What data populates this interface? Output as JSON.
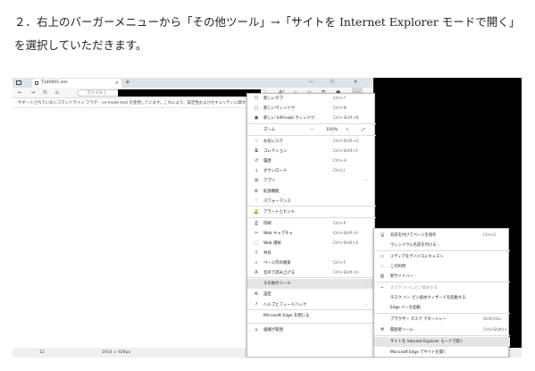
{
  "instruction": "２．右上のバーガーメニューから「その他ツール」→「サイトを Internet Explorer モードで開く」を選択していただきます。",
  "browser": {
    "tab_title": "T140001.xml",
    "tab_close": "×",
    "new_tab": "+",
    "window_buttons": {
      "minimize": "—",
      "maximize": "☐",
      "close": "✕"
    },
    "address_label": "ファイル |",
    "infobar_text": "サポートされていないコマンドライン フラグ: --ie-mode-test を使用しています。これにより、安定性およびセキュリティに関する",
    "status_left": "12",
    "status_mid": "1914 × 929px"
  },
  "menu": {
    "items": [
      {
        "icon": "new-tab-icon",
        "glyph": "☐",
        "label": "新しいタブ",
        "shortcut": "Ctrl+T"
      },
      {
        "icon": "new-window-icon",
        "glyph": "▢",
        "label": "新しいウィンドウ",
        "shortcut": "Ctrl+N"
      },
      {
        "icon": "inprivate-icon",
        "glyph": "▣",
        "label": "新しい InPrivate ウィンドウ",
        "shortcut": "Ctrl+Shift+N"
      },
      {
        "icon": "favorites-icon",
        "glyph": "☆",
        "label": "お気に入り",
        "shortcut": "Ctrl+Shift+O"
      },
      {
        "icon": "collections-icon",
        "glyph": "⧉",
        "label": "コレクション",
        "shortcut": "Ctrl+Shift+Y"
      },
      {
        "icon": "history-icon",
        "glyph": "↺",
        "label": "履歴",
        "shortcut": "Ctrl+H"
      },
      {
        "icon": "download-icon",
        "glyph": "↓",
        "label": "ダウンロード",
        "shortcut": "Ctrl+J"
      },
      {
        "icon": "apps-icon",
        "glyph": "⊞",
        "label": "アプリ",
        "arrow": "›"
      },
      {
        "icon": "extensions-icon",
        "glyph": "⚙",
        "label": "拡張機能"
      },
      {
        "icon": "performance-icon",
        "glyph": "♡",
        "label": "パフォーマンス"
      },
      {
        "icon": "alerts-icon",
        "glyph": "🔔",
        "label": "アラートとヒント"
      },
      {
        "icon": "print-icon",
        "glyph": "⎙",
        "label": "印刷",
        "shortcut": "Ctrl+P"
      },
      {
        "icon": "web-capture-icon",
        "glyph": "✂",
        "label": "Web キャプチャ",
        "shortcut": "Ctrl+Shift+S"
      },
      {
        "icon": "web-select-icon",
        "glyph": "⬚",
        "label": "Web 選択",
        "shortcut": "Ctrl+Shift+X"
      },
      {
        "icon": "share-icon",
        "glyph": "⇪",
        "label": "共有"
      },
      {
        "icon": "find-icon",
        "glyph": "⌕",
        "label": "ページ内の検索",
        "shortcut": "Ctrl+F"
      },
      {
        "icon": "read-aloud-icon",
        "glyph": "A",
        "label": "音声で読み上げる",
        "shortcut": "Ctrl+Shift+U"
      },
      {
        "icon": "more-tools-icon",
        "glyph": "",
        "label": "その他のツール",
        "arrow": "›"
      },
      {
        "icon": "settings-icon",
        "glyph": "⚙",
        "label": "設定"
      },
      {
        "icon": "help-icon",
        "glyph": "?",
        "label": "ヘルプとフィードバック",
        "arrow": "›"
      },
      {
        "icon": "close-edge-icon",
        "glyph": "",
        "label": "Microsoft Edge を閉じる"
      },
      {
        "icon": "managed-icon",
        "glyph": "⌂",
        "label": "組織が管理"
      }
    ],
    "zoom": {
      "label": "ズーム",
      "minus": "—",
      "value": "100%",
      "plus": "+",
      "fullscreen": "⤢"
    }
  },
  "submenu": {
    "items": [
      {
        "icon": "save-page-icon",
        "glyph": "🖫",
        "label": "名前を付けてページを保存",
        "shortcut": "Ctrl+S"
      },
      {
        "icon": "",
        "glyph": "",
        "label": "ウィンドウに名前を付ける..."
      },
      {
        "icon": "cast-icon",
        "glyph": "▭",
        "label": "メディアをデバイスにキャスト"
      },
      {
        "icon": "qr-icon",
        "glyph": "⁙",
        "label": "この利用"
      },
      {
        "icon": "sidebar-icon",
        "glyph": "▥",
        "label": "新サイドバー"
      },
      {
        "icon": "pin-taskbar-icon",
        "glyph": "⌁",
        "label": "タスク バーにピン留めする",
        "disabled": true
      },
      {
        "icon": "",
        "glyph": "",
        "label": "タスク バー ピン留めウィザードを起動する"
      },
      {
        "icon": "",
        "glyph": "",
        "label": "Edge バーを起動"
      },
      {
        "icon": "",
        "glyph": "",
        "label": "ブラウザー タスク マネージャー",
        "shortcut": "Shift+Esc"
      },
      {
        "icon": "dev-tools-icon",
        "glyph": "⚒",
        "label": "開発者ツール",
        "shortcut": "Ctrl+Shift+I"
      },
      {
        "icon": "",
        "glyph": "",
        "label": "サイトを Internet Explorer モードで開く"
      },
      {
        "icon": "",
        "glyph": "",
        "label": "Microsoft Edge でサイトを開く"
      }
    ]
  }
}
